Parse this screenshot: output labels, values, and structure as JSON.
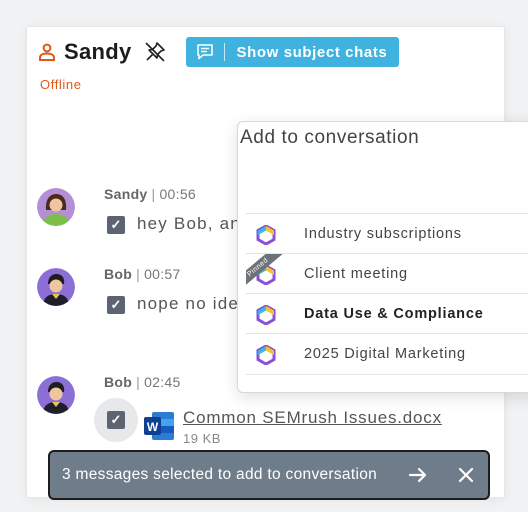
{
  "header": {
    "contact_name": "Sandy",
    "status": "Offline",
    "subject_chats_label": "Show subject chats",
    "accent": "#3fb2df",
    "status_color": "#e0581c"
  },
  "messages": [
    {
      "sender": "Sandy",
      "separator": "|",
      "time": "00:56",
      "text": "hey Bob, an",
      "checked": true,
      "avatar": "female-avatar"
    },
    {
      "sender": "Bob",
      "separator": "|",
      "time": "00:57",
      "text": "nope no ide",
      "checked": true,
      "avatar": "male-avatar"
    },
    {
      "sender": "Bob",
      "separator": "|",
      "time": "02:45",
      "checked": true,
      "avatar": "male-avatar",
      "attachment": {
        "name": "Common SEMrush Issues.docx",
        "size": "19 KB",
        "icon": "word-icon"
      }
    }
  ],
  "popup": {
    "title": "Add to conversation",
    "items": [
      {
        "label": "Industry subscriptions",
        "pinned": false,
        "bold": false
      },
      {
        "label": "Client meeting",
        "pinned": true,
        "ribbon": "Pinned",
        "bold": false
      },
      {
        "label": "Data Use & Compliance",
        "pinned": false,
        "bold": true
      },
      {
        "label": "2025 Digital Marketing",
        "pinned": false,
        "bold": false
      }
    ]
  },
  "snackbar": {
    "text": "3 messages selected to add to conversation",
    "background": "#6f7d8b"
  }
}
